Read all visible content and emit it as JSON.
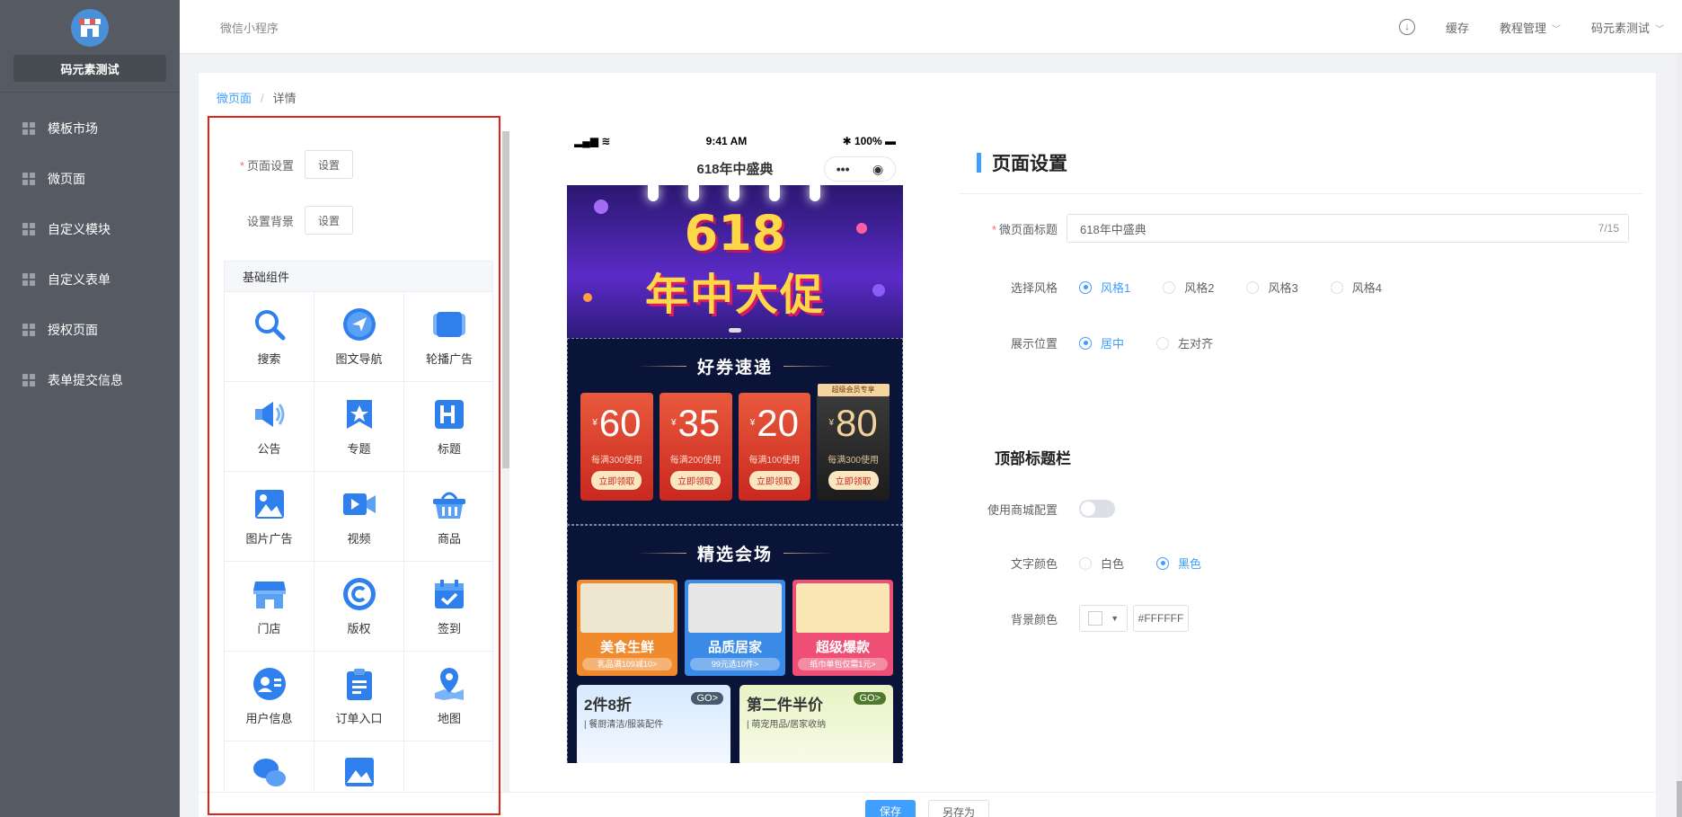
{
  "sidebar": {
    "shop_name": "码元素测试",
    "items": [
      {
        "label": "模板市场"
      },
      {
        "label": "微页面"
      },
      {
        "label": "自定义模块"
      },
      {
        "label": "自定义表单"
      },
      {
        "label": "授权页面"
      },
      {
        "label": "表单提交信息"
      }
    ]
  },
  "topbar": {
    "app_name": "微信小程序",
    "cache": "缓存",
    "tutorial": "教程管理",
    "user": "码元素测试"
  },
  "breadcrumb": {
    "link": "微页面",
    "sep": "/",
    "current": "详情"
  },
  "component_panel": {
    "page_settings_label": "页面设置",
    "bg_settings_label": "设置背景",
    "set_button": "设置",
    "group_title": "基础组件",
    "components": [
      {
        "label": "搜索",
        "icon": "search-icon"
      },
      {
        "label": "图文导航",
        "icon": "navigation-icon"
      },
      {
        "label": "轮播广告",
        "icon": "carousel-icon"
      },
      {
        "label": "公告",
        "icon": "speaker-icon"
      },
      {
        "label": "专题",
        "icon": "topic-icon"
      },
      {
        "label": "标题",
        "icon": "heading-icon"
      },
      {
        "label": "图片广告",
        "icon": "image-icon"
      },
      {
        "label": "视频",
        "icon": "video-icon"
      },
      {
        "label": "商品",
        "icon": "basket-icon"
      },
      {
        "label": "门店",
        "icon": "store-icon"
      },
      {
        "label": "版权",
        "icon": "copyright-icon"
      },
      {
        "label": "签到",
        "icon": "checkin-icon"
      },
      {
        "label": "用户信息",
        "icon": "user-icon"
      },
      {
        "label": "订单入口",
        "icon": "clipboard-icon"
      },
      {
        "label": "地图",
        "icon": "map-pin-icon"
      },
      {
        "label": "",
        "icon": "chat-icon"
      },
      {
        "label": "",
        "icon": "picture-icon"
      }
    ]
  },
  "phone": {
    "time": "9:41 AM",
    "battery": "100%",
    "title": "618年中盛典",
    "banner_number": "618",
    "banner_text": "年中大促",
    "coupon_section_title": "好券速递",
    "coupons": [
      {
        "currency": "¥",
        "amount": "60",
        "condition": "每满300使用",
        "button": "立即领取",
        "tag": ""
      },
      {
        "currency": "¥",
        "amount": "35",
        "condition": "每满200使用",
        "button": "立即领取",
        "tag": ""
      },
      {
        "currency": "¥",
        "amount": "20",
        "condition": "每满100使用",
        "button": "立即领取",
        "tag": ""
      },
      {
        "currency": "¥",
        "amount": "80",
        "condition": "每满300使用",
        "button": "立即领取",
        "tag": "超级会员专享"
      }
    ],
    "venue_section_title": "精选会场",
    "venues": [
      {
        "name": "美食生鲜",
        "sub": "乳品满109减10>"
      },
      {
        "name": "品质居家",
        "sub": "99元选10件>"
      },
      {
        "name": "超级爆款",
        "sub": "纸巾单包仅需1元>"
      }
    ],
    "promos": [
      {
        "title": "2件8折",
        "sub": "| 餐厨清洁/服装配件",
        "go": "GO>"
      },
      {
        "title": "第二件半价",
        "sub": "| 萌宠用品/居家收纳",
        "go": "GO>"
      }
    ]
  },
  "settings": {
    "title": "页面设置",
    "page_title_label": "微页面标题",
    "page_title_value": "618年中盛典",
    "page_title_count": "7/15",
    "style_label": "选择风格",
    "styles": [
      "风格1",
      "风格2",
      "风格3",
      "风格4"
    ],
    "position_label": "展示位置",
    "positions": [
      "居中",
      "左对齐"
    ],
    "top_bar_title": "顶部标题栏",
    "use_mall_label": "使用商城配置",
    "text_color_label": "文字颜色",
    "text_colors": [
      "白色",
      "黑色"
    ],
    "bg_color_label": "背景颜色",
    "bg_color_value": "#FFFFFF"
  },
  "bottom": {
    "save": "保存",
    "save_as": "另存为"
  },
  "colors": {
    "sidebar_bg": "#565b63",
    "accent": "#409eff",
    "highlight_frame": "#e2231a"
  }
}
